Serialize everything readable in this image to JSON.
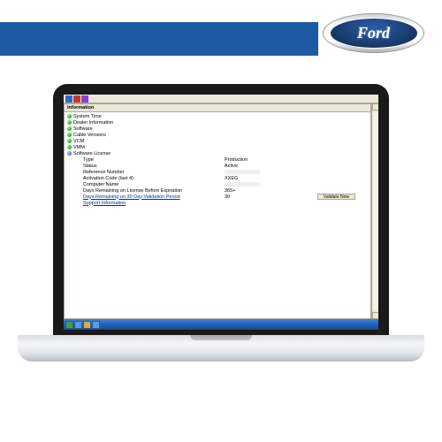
{
  "brand": "Ford",
  "panel": {
    "title": "Information"
  },
  "tree": {
    "items": [
      {
        "label": "System Time"
      },
      {
        "label": "Dealer Information"
      },
      {
        "label": "Software"
      },
      {
        "label": "Cable Versions"
      },
      {
        "label": "VCM"
      },
      {
        "label": "VMM"
      },
      {
        "label": "Software License"
      }
    ]
  },
  "license": {
    "rows": [
      {
        "label": "Type",
        "value": "Production"
      },
      {
        "label": "Status",
        "value": "Active"
      },
      {
        "label": "Reference Number",
        "value": ""
      },
      {
        "label": "Activation Code (last 4)",
        "value": "XXEG"
      },
      {
        "label": "Computer Name",
        "value": ""
      },
      {
        "label": "Days Remaining on License Before Expiration",
        "value": "365+"
      },
      {
        "label": "Days Remaining on 30 Day Validation Period",
        "value": "30",
        "link": true,
        "button": "Validate Now"
      },
      {
        "label": "Support Information",
        "value": "",
        "link": true
      }
    ]
  },
  "buttons": {
    "validate": "Validate Now"
  }
}
